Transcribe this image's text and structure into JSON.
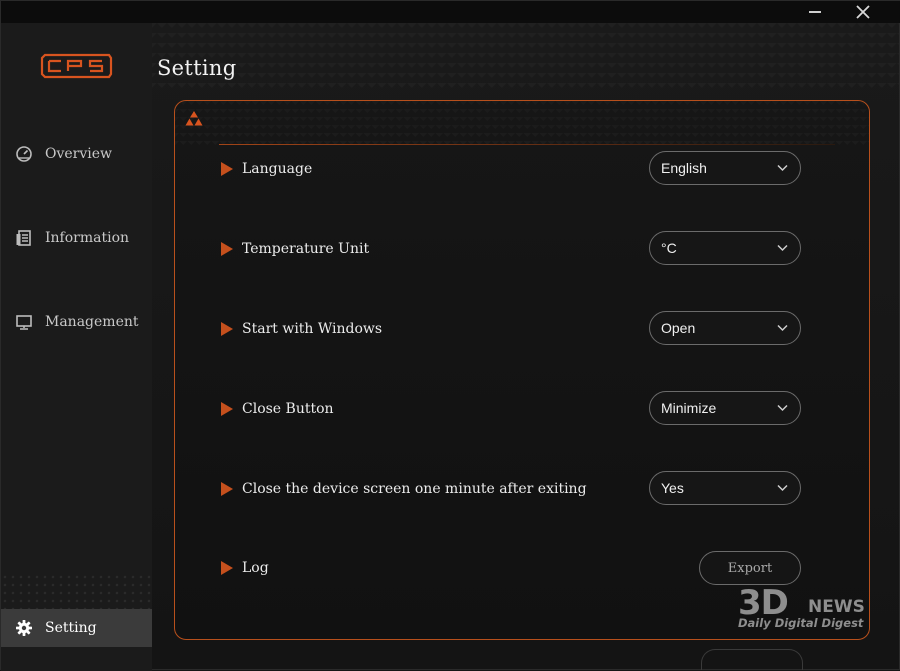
{
  "window": {
    "minimize_icon": "minimize-icon",
    "close_icon": "close-icon"
  },
  "sidebar": {
    "logo_text": "CPS",
    "items": [
      {
        "label": "Overview",
        "icon": "speedometer-icon"
      },
      {
        "label": "Information",
        "icon": "document-icon"
      },
      {
        "label": "Management",
        "icon": "monitor-icon"
      },
      {
        "label": "Setting",
        "icon": "gear-icon",
        "active": true
      }
    ]
  },
  "page": {
    "title": "Setting"
  },
  "settings": [
    {
      "label": "Language",
      "value": "English"
    },
    {
      "label": "Temperature Unit",
      "value": "°C"
    },
    {
      "label": "Start with Windows",
      "value": "Open"
    },
    {
      "label": "Close Button",
      "value": "Minimize"
    },
    {
      "label": "Close the device screen one minute after exiting",
      "value": "Yes"
    },
    {
      "label": "Log",
      "button": "Export"
    }
  ],
  "watermark": {
    "big": "3D",
    "news": "NEWS",
    "sub": "Daily Digital Digest"
  },
  "colors": {
    "accent": "#c5501d",
    "border_accent": "#b8501c",
    "background": "#141414",
    "sidebar": "#1b1b1b",
    "active_item": "#3b3b3b"
  }
}
